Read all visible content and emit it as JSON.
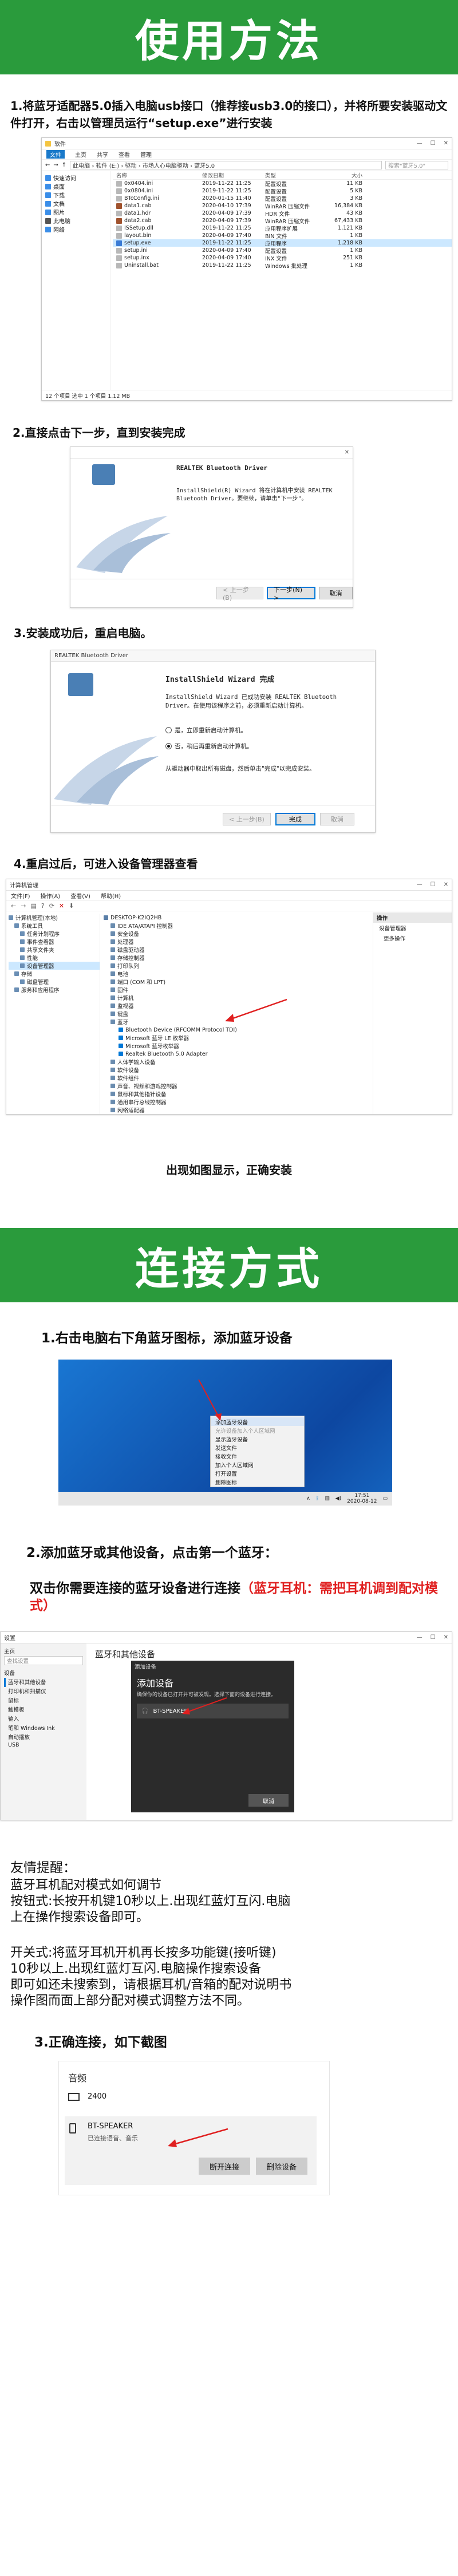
{
  "sections": {
    "usage_title": "使用方法",
    "connect_title": "连接方式"
  },
  "steps": {
    "s1": "1.将蓝牙适配器5.0插入电脑usb接口（推荐接usb3.0的接口），并将所要安装驱动文件打开，右击以管理员运行“setup.exe”进行安装",
    "s2": "2.直接点击下一步，直到安装完成",
    "s3": "3.安装成功后，重启电脑。",
    "s4": "4.重启过后，可进入设备管理器查看",
    "s4_result": "出现如图显示，正确安装",
    "c1": "1.右击电脑右下角蓝牙图标，添加蓝牙设备",
    "c2": "2.添加蓝牙或其他设备，点击第一个蓝牙：",
    "c2_sub_black": "双击你需要连接的蓝牙设备进行连接",
    "c2_sub_red": "（蓝牙耳机：需把耳机调到配对模式）",
    "c3": "3.正确连接，如下截图"
  },
  "explorer": {
    "title": "软件",
    "menu": [
      "文件",
      "主页",
      "共享",
      "查看",
      "管理"
    ],
    "path": "此电脑 › 软件 (E:) › 驱动 › 市场人心电脑驱动 › 蓝牙5.0",
    "search": "搜索\"蓝牙5.0\"",
    "sidebar": [
      "快速访问",
      "桌面",
      "下载",
      "文档",
      "图片",
      "此电脑",
      "网络"
    ],
    "headers": [
      "名称",
      "修改日期",
      "类型",
      "大小"
    ],
    "files": [
      {
        "name": "0x0404.ini",
        "date": "2019-11-22 11:25",
        "type": "配置设置",
        "size": "11 KB"
      },
      {
        "name": "0x0804.ini",
        "date": "2019-11-22 11:25",
        "type": "配置设置",
        "size": "5 KB"
      },
      {
        "name": "BTcConfig.ini",
        "date": "2020-01-15 11:40",
        "type": "配置设置",
        "size": "3 KB"
      },
      {
        "name": "data1.cab",
        "date": "2020-04-10 17:39",
        "type": "WinRAR 压缩文件",
        "size": "16,384 KB"
      },
      {
        "name": "data1.hdr",
        "date": "2020-04-09 17:39",
        "type": "HDR 文件",
        "size": "43 KB"
      },
      {
        "name": "data2.cab",
        "date": "2020-04-09 17:39",
        "type": "WinRAR 压缩文件",
        "size": "67,433 KB"
      },
      {
        "name": "ISSetup.dll",
        "date": "2019-11-22 11:25",
        "type": "应用程序扩展",
        "size": "1,121 KB"
      },
      {
        "name": "layout.bin",
        "date": "2020-04-09 17:40",
        "type": "BIN 文件",
        "size": "1 KB"
      },
      {
        "name": "setup.exe",
        "date": "2019-11-22 11:25",
        "type": "应用程序",
        "size": "1,218 KB"
      },
      {
        "name": "setup.ini",
        "date": "2020-04-09 17:40",
        "type": "配置设置",
        "size": "1 KB"
      },
      {
        "name": "setup.inx",
        "date": "2020-04-09 17:40",
        "type": "INX 文件",
        "size": "251 KB"
      },
      {
        "name": "Uninstall.bat",
        "date": "2019-11-22 11:25",
        "type": "Windows 批处理",
        "size": "1 KB"
      }
    ],
    "status": "12 个项目   选中 1 个项目 1.12 MB"
  },
  "installer1": {
    "title": "REALTEK Bluetooth Driver",
    "body": "InstallShield(R) Wizard 将在计算机中安装 REALTEK Bluetooth Driver。要继续，请单击\"下一步\"。",
    "back": "< 上一步(B)",
    "next": "下一步(N) >",
    "cancel": "取消"
  },
  "installer2": {
    "title": "REALTEK Bluetooth Driver",
    "heading": "InstallShield Wizard 完成",
    "body": "InstallShield Wizard 已成功安装 REALTEK Bluetooth Driver。在使用该程序之前，必须重新启动计算机。",
    "opt_yes": "是，立即重新启动计算机。",
    "opt_no": "否，稍后再重新启动计算机。",
    "footer": "从驱动器中取出所有磁盘，然后单击\"完成\"以完成安装。",
    "back": "< 上一步(B)",
    "finish": "完成",
    "cancel": "取消"
  },
  "devmgr": {
    "title": "计算机管理",
    "menu": [
      "文件(F)",
      "操作(A)",
      "查看(V)",
      "帮助(H)"
    ],
    "left_tree": [
      "计算机管理(本地)",
      "系统工具",
      "任务计划程序",
      "事件查看器",
      "共享文件夹",
      "性能",
      "设备管理器",
      "存储",
      "磁盘管理",
      "服务和应用程序"
    ],
    "root": "DESKTOP-K2IQ2HB",
    "items": [
      "IDE ATA/ATAPI 控制器",
      "安全设备",
      "处理器",
      "磁盘驱动器",
      "存储控制器",
      "打印队列",
      "电池",
      "端口 (COM 和 LPT)",
      "固件",
      "计算机",
      "监视器",
      "键盘",
      "蓝牙"
    ],
    "bt_children": [
      "Bluetooth Device (RFCOMM Protocol TDI)",
      "Microsoft 蓝牙 LE 枚举器",
      "Microsoft 蓝牙枚举器",
      "Realtek Bluetooth 5.0 Adapter"
    ],
    "items_after": [
      "人体学输入设备",
      "软件设备",
      "软件组件",
      "声音、视频和游戏控制器",
      "鼠标和其他指针设备",
      "通用串行总线控制器",
      "网络适配器",
      "系统设备",
      "显示适配器",
      "音频输入和输出"
    ],
    "actions_title": "操作",
    "actions": [
      "设备管理器",
      "更多操作"
    ]
  },
  "tray_menu": {
    "items": [
      "添加蓝牙设备",
      "允许设备加入个人区域网",
      "显示蓝牙设备",
      "发送文件",
      "接收文件",
      "加入个人区域网",
      "打开设置",
      "删除图标"
    ],
    "time": "17:51",
    "date": "2020-08-12"
  },
  "settings": {
    "side_title": "设置",
    "home": "主页",
    "search": "查找设置",
    "side_items": [
      "设备",
      "蓝牙和其他设备",
      "打印机和扫描仪",
      "鼠标",
      "触摸板",
      "输入",
      "笔和 Windows Ink",
      "自动播放",
      "USB"
    ],
    "main_title": "蓝牙和其他设备",
    "dialog_title": "添加设备",
    "dialog_heading": "添加设备",
    "dialog_sub": "确保你的设备已打开并可被发现。选择下面的设备进行连接。",
    "found": "BT-SPEAKER",
    "cancel": "取消"
  },
  "tips": {
    "title": "友情提醒：",
    "l1": "蓝牙耳机配对模式如何调节",
    "l2": "按钮式:长按开机键10秒以上.出现红蓝灯互闪.电脑",
    "l3": "上在操作搜索设备即可。",
    "l4": "开关式:将蓝牙耳机开机再长按多功能键(接听键)",
    "l5": "10秒以上.出现红蓝灯互闪.电脑操作搜索设备",
    "l6": "即可如还未搜索到，请根据耳机/音箱的配对说明书",
    "l7": "操作图而面上部分配对模式调整方法不同。"
  },
  "audio": {
    "heading": "音频",
    "dev1": "2400",
    "dev2": "BT-SPEAKER",
    "dev2_status": "已连接语音、音乐",
    "disconnect": "断开连接",
    "remove": "删除设备"
  },
  "colors": {
    "green": "#2a9b3c",
    "red": "#e02020",
    "blue": "#0078d7",
    "desktop_blue": "#1565c0"
  }
}
